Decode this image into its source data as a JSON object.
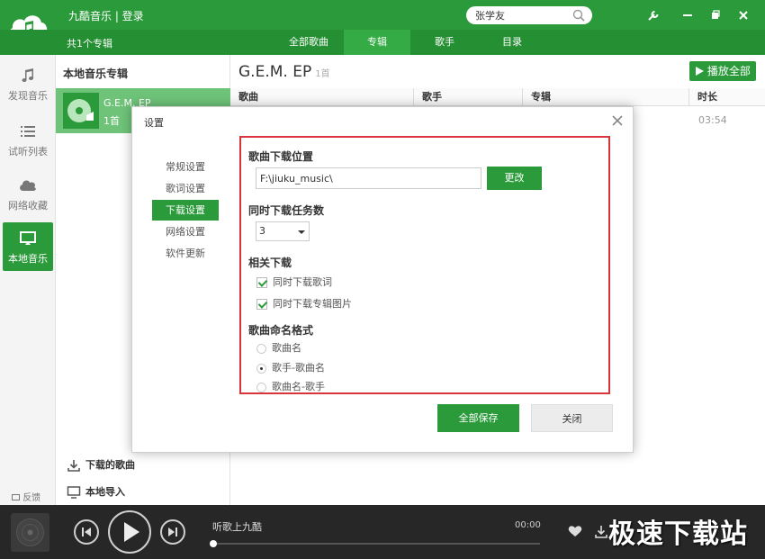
{
  "app": {
    "title": "九酷音乐 | 登录"
  },
  "search": {
    "value": "张学友"
  },
  "subbar": {
    "album_count": "共1个专辑",
    "tabs": [
      {
        "label": "全部歌曲"
      },
      {
        "label": "专辑"
      },
      {
        "label": "歌手"
      },
      {
        "label": "目录"
      }
    ]
  },
  "sidebar": {
    "items": [
      {
        "label": "发现音乐",
        "icon": "music-note-icon"
      },
      {
        "label": "试听列表",
        "icon": "list-icon"
      },
      {
        "label": "网络收藏",
        "icon": "cloud-icon"
      },
      {
        "label": "本地音乐",
        "icon": "monitor-icon"
      }
    ],
    "feedback": "反馈"
  },
  "album_panel": {
    "header": "本地音乐专辑",
    "album": {
      "name": "G.E.M. EP",
      "count": "1首"
    },
    "downloaded_link": "下载的歌曲",
    "import_link": "本地导入"
  },
  "main": {
    "title": "G.E.M. EP",
    "count": "1首",
    "play_all": "播放全部",
    "columns": [
      "歌曲",
      "歌手",
      "专辑",
      "时长"
    ],
    "duration": "03:54"
  },
  "dialog": {
    "title": "设置",
    "nav": [
      {
        "label": "常规设置"
      },
      {
        "label": "歌词设置"
      },
      {
        "label": "下载设置"
      },
      {
        "label": "网络设置"
      },
      {
        "label": "软件更新"
      }
    ],
    "download_location_title": "歌曲下载位置",
    "download_path": "F:\\jiuku_music\\",
    "change_button": "更改",
    "concurrent_title": "同时下载任务数",
    "concurrent_value": "3",
    "related_title": "相关下载",
    "related_options": [
      {
        "label": "同时下载歌词",
        "checked": true
      },
      {
        "label": "同时下载专辑图片",
        "checked": true
      }
    ],
    "naming_title": "歌曲命名格式",
    "naming_options": [
      {
        "label": "歌曲名",
        "selected": false
      },
      {
        "label": "歌手-歌曲名",
        "selected": true
      },
      {
        "label": "歌曲名-歌手",
        "selected": false
      }
    ],
    "save_button": "全部保存",
    "close_button": "关闭"
  },
  "player": {
    "song": "听歌上九酷",
    "time": "00:00",
    "progress": 0
  },
  "watermark": "极速下载站",
  "colors": {
    "brand_green": "#2b9a3a",
    "highlight_red": "#d7343c"
  }
}
